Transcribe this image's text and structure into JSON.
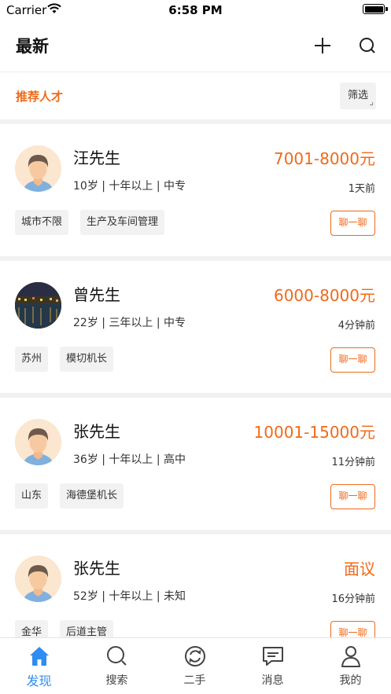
{
  "status_bar": {
    "carrier": "Carrier",
    "time": "6:58 PM"
  },
  "nav": {
    "title": "最新"
  },
  "filter": {
    "section_label": "推荐人才",
    "filter_button": "筛选"
  },
  "candidates": [
    {
      "name": "汪先生",
      "salary": "7001-8000元",
      "meta": "10岁 | 十年以上 | 中专",
      "time": "1天前",
      "tags": [
        "城市不限",
        "生产及车间管理"
      ],
      "chat_label": "聊一聊",
      "avatar": "default-male-avatar"
    },
    {
      "name": "曾先生",
      "salary": "6000-8000元",
      "meta": "22岁 | 三年以上 | 中专",
      "time": "4分钟前",
      "tags": [
        "苏州",
        "模切机长"
      ],
      "chat_label": "聊一聊",
      "avatar": "night-river-photo-avatar"
    },
    {
      "name": "张先生",
      "salary": "10001-15000元",
      "meta": "36岁 | 十年以上 | 高中",
      "time": "11分钟前",
      "tags": [
        "山东",
        "海德堡机长"
      ],
      "chat_label": "聊一聊",
      "avatar": "default-male-avatar"
    },
    {
      "name": "张先生",
      "salary": "面议",
      "meta": "52岁 | 十年以上 | 未知",
      "time": "16分钟前",
      "tags": [
        "金华",
        "后道主管"
      ],
      "chat_label": "聊一聊",
      "avatar": "default-male-avatar"
    }
  ],
  "tabbar": {
    "items": [
      {
        "label": "发现",
        "icon": "home-icon",
        "active": true
      },
      {
        "label": "搜索",
        "icon": "search-icon",
        "active": false
      },
      {
        "label": "二手",
        "icon": "recycle-icon",
        "active": false
      },
      {
        "label": "消息",
        "icon": "message-icon",
        "active": false
      },
      {
        "label": "我的",
        "icon": "user-icon",
        "active": false
      }
    ]
  },
  "colors": {
    "accent": "#ef6a1a",
    "tab_active": "#2f8cf0",
    "tag_bg": "#f2f2f2",
    "separator": "#f1f1f1"
  }
}
